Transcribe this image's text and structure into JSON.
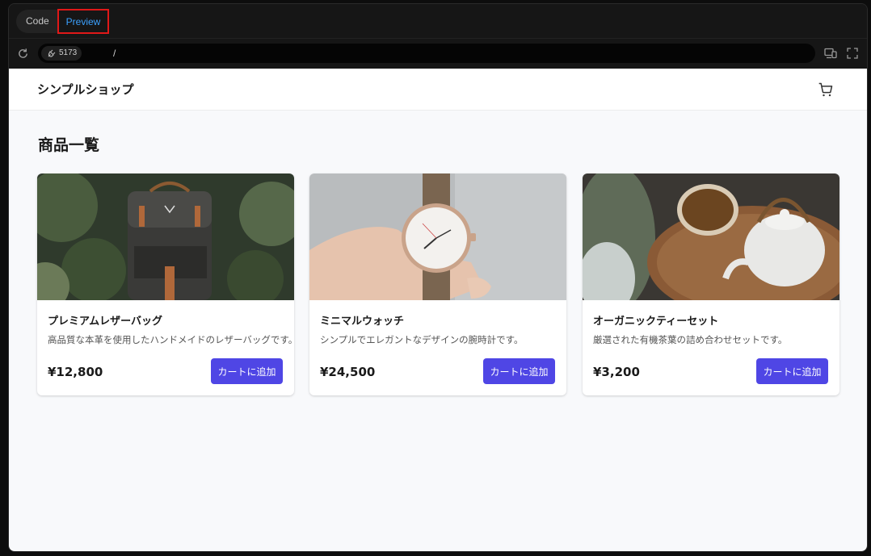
{
  "tabs": {
    "code": "Code",
    "preview": "Preview"
  },
  "urlbar": {
    "port": "5173",
    "path": "/"
  },
  "header": {
    "shop_name": "シンプルショップ"
  },
  "main": {
    "title": "商品一覧",
    "products": [
      {
        "name": "プレミアムレザーバッグ",
        "description": "高品質な本革を使用したハンドメイドのレザーバッグです。",
        "price": "¥12,800",
        "button": "カートに追加"
      },
      {
        "name": "ミニマルウォッチ",
        "description": "シンプルでエレガントなデザインの腕時計です。",
        "price": "¥24,500",
        "button": "カートに追加"
      },
      {
        "name": "オーガニックティーセット",
        "description": "厳選された有機茶葉の詰め合わせセットです。",
        "price": "¥3,200",
        "button": "カートに追加"
      }
    ]
  },
  "colors": {
    "accent": "#4f46e5",
    "preview_tab": "#3ba1ff",
    "highlight_border": "#e01818"
  },
  "icons": [
    "reload-icon",
    "plug-icon",
    "devices-icon",
    "fullscreen-icon",
    "cart-icon"
  ]
}
